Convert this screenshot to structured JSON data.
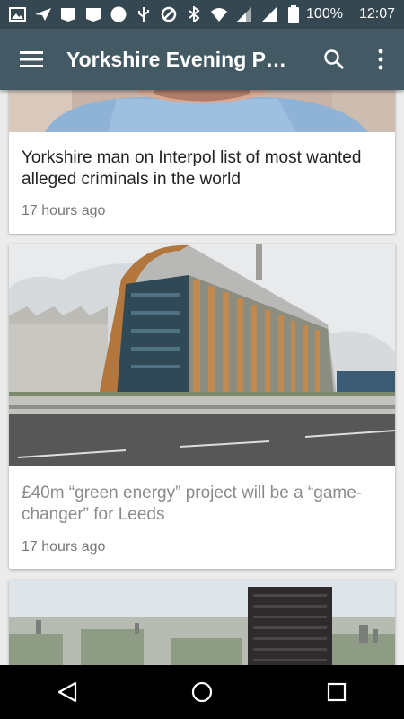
{
  "status_bar": {
    "battery": "100%",
    "time": "12:07",
    "icons": [
      "image-icon",
      "send-icon",
      "notification-icon",
      "notification-icon",
      "circle-icon",
      "usb-icon",
      "block-icon",
      "bluetooth-icon",
      "wifi-icon",
      "signal-icon",
      "signal-icon",
      "battery-icon"
    ]
  },
  "app_bar": {
    "title": "Yorkshire Evening Po…",
    "menu_icon": "hamburger-menu-icon",
    "search_icon": "search-icon",
    "more_icon": "more-vertical-icon",
    "color": "#435a64"
  },
  "articles": [
    {
      "headline": "Yorkshire man on Interpol list of most wanted alleged criminals in the world",
      "time": "17 hours ago",
      "headline_color": "#222222"
    },
    {
      "headline": "£40m “green energy” project will be a “game-changer” for Leeds",
      "time": "17 hours ago",
      "headline_color": "#8a8a8a"
    },
    {
      "headline": "",
      "time": ""
    }
  ],
  "nav_bar": {
    "back_icon": "back-triangle-icon",
    "home_icon": "home-circle-icon",
    "recents_icon": "recents-square-icon"
  }
}
